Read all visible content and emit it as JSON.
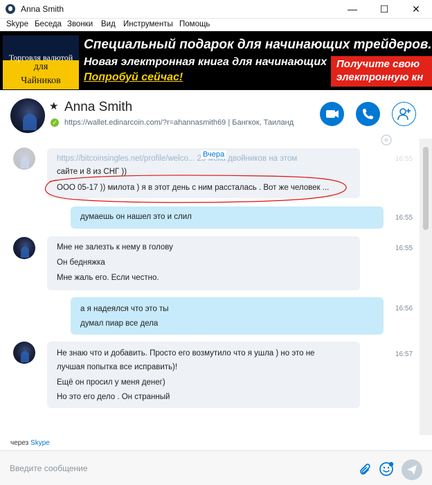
{
  "window": {
    "title": "Anna Smith",
    "minimize_glyph": "—",
    "maximize_glyph": "☐",
    "close_glyph": "✕"
  },
  "menu": [
    "Skype",
    "Беседа",
    "Звонки",
    "Вид",
    "Инструменты",
    "Помощь"
  ],
  "banner": {
    "book_line1": "Торговля валютой",
    "book_line2": "для",
    "book_line3": "Чайников",
    "headline": "Специальный подарок для начинающих трейдеров.",
    "subline": "Новая электронная книга для начинающих",
    "cta": "Попробуй сейчас!",
    "red_line1": "Получите свою",
    "red_line2": "электронную кн"
  },
  "contact": {
    "name": "Anna Smith",
    "mood": "https://wallet.edinarcoin.com/?r=ahannasmith69  |  Бангкок, Таиланд",
    "buttons": [
      "video-call",
      "audio-call",
      "add-people"
    ]
  },
  "chat": {
    "date_separator": "Вчера",
    "faded_top": "https://bitcoinsingles.net/profile/welco...   29 мска двойников на этом",
    "msg1_line1": "сайте и 8 из СНГ ))",
    "msg1_line2": "ООО 05-17 )) милота ) я в этот день с ним рассталась . Вот же человек ...",
    "msg1_time": "16:55",
    "msg2_text": "думаешь он нашел это и слил",
    "msg2_time": "16:55",
    "msg3_lines": [
      "Мне не залезть к нему в голову",
      "Он бедняжка",
      "Мне жаль его. Если честно."
    ],
    "msg3_time": "16:55",
    "msg4_lines": [
      "а я надеялся что это ты",
      "думал пиар все дела"
    ],
    "msg4_time": "16:56",
    "msg5_lines": [
      "Не знаю что и добавить. Просто его возмутило что я ушла ) но это не",
      "лучшая попытка все исправить)!",
      "Ещё он просил у меня денег)",
      "Но это его дело . Он странный"
    ],
    "msg5_time": "16:57"
  },
  "footer": {
    "via_prefix": "через",
    "via_link": "Skype",
    "input_placeholder": "Введите сообщение"
  },
  "colors": {
    "accent": "#0078d4",
    "online": "#7cbf2d",
    "incoming_bubble": "#eef1f5",
    "outgoing_bubble": "#c7ebfa",
    "annotation_red": "#d11"
  }
}
